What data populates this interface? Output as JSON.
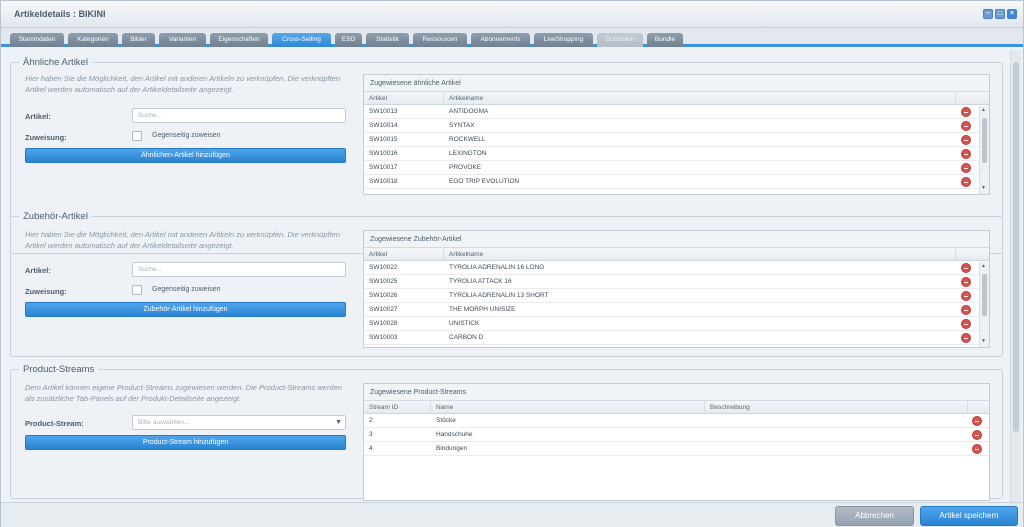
{
  "window": {
    "title": "Artikeldetails : BIKINI",
    "buttons": [
      "min",
      "max",
      "close"
    ]
  },
  "tabs": [
    {
      "label": "Stammdaten",
      "state": "normal"
    },
    {
      "label": "Kategorien",
      "state": "normal"
    },
    {
      "label": "Bilder",
      "state": "normal"
    },
    {
      "label": "Varianten",
      "state": "normal"
    },
    {
      "label": "Eigenschaften",
      "state": "normal"
    },
    {
      "label": "Cross-Selling",
      "state": "active"
    },
    {
      "label": "ESD",
      "state": "normal"
    },
    {
      "label": "Statistik",
      "state": "normal"
    },
    {
      "label": "Ressourcen",
      "state": "normal"
    },
    {
      "label": "Abonnements",
      "state": "normal"
    },
    {
      "label": "LiveShopping",
      "state": "normal"
    },
    {
      "label": "Gutschein",
      "state": "disabled"
    },
    {
      "label": "Bundle",
      "state": "normal"
    }
  ],
  "similar": {
    "legend": "Ähnliche Artikel",
    "description": "Hier haben Sie die Möglichkeit, den Artikel mit anderen Artikeln zu verknüpfen. Die verknüpften Artikel werden automatisch auf der Artikeldetailseite angezeigt.",
    "article_label": "Artikel:",
    "search_placeholder": "Suche...",
    "assignment_label": "Zuweisung:",
    "checkbox_label": "Gegenseitig zuweisen",
    "button": "Ähnlichen-Artikel hinzufügen",
    "grid_title": "Zugewiesene ähnliche Artikel",
    "columns": [
      "Artikel",
      "Artikelname"
    ],
    "rows": [
      [
        "SW10013",
        "ANTIDOGMA"
      ],
      [
        "SW10014",
        "SYNTAX"
      ],
      [
        "SW10015",
        "ROCKWELL"
      ],
      [
        "SW10016",
        "LEXINGTON"
      ],
      [
        "SW10017",
        "PROVOKE"
      ],
      [
        "SW10018",
        "EGO TRIP EVOLUTION"
      ]
    ]
  },
  "accessory": {
    "legend": "Zubehör-Artikel",
    "description": "Hier haben Sie die Möglichkeit, den Artikel mit anderen Artikeln zu verknüpfen. Die verknüpften Artikel werden automatisch auf der Artikeldetailseite angezeigt.",
    "article_label": "Artikel:",
    "search_placeholder": "Suche...",
    "assignment_label": "Zuweisung:",
    "checkbox_label": "Gegenseitig zuweisen",
    "button": "Zubehör-Artikel hinzufügen",
    "grid_title": "Zugewiesene Zubehör-Artikel",
    "columns": [
      "Artikel",
      "Artikelname"
    ],
    "rows": [
      [
        "SW10022",
        "TYROLIA ADRENALIN 16 LONG"
      ],
      [
        "SW10025",
        "TYROLIA ATTACK 16"
      ],
      [
        "SW10026",
        "TYROLIA ADRENALIN 13 SHORT"
      ],
      [
        "SW10027",
        "THE MORPH UNISIZE"
      ],
      [
        "SW10028",
        "UNISTICK"
      ],
      [
        "SW10003",
        "CARBON D"
      ]
    ]
  },
  "streams": {
    "legend": "Product-Streams",
    "description": "Dem Artikel können eigene Product-Streams zugewiesen werden. Die Product-Streams werden als zusätzliche Tab-Panels auf der Produkt-Detailseite angezeigt.",
    "stream_label": "Product-Stream:",
    "select_placeholder": "Bitte auswählen...",
    "button": "Product-Stream hinzufügen",
    "grid_title": "Zugewiesene Product-Streams",
    "columns": [
      "Stream ID",
      "Name",
      "Beschreibung"
    ],
    "rows": [
      [
        "2",
        "Stöcke",
        ""
      ],
      [
        "3",
        "Handschuhe",
        ""
      ],
      [
        "4",
        "Bindungen",
        ""
      ]
    ]
  },
  "footer": {
    "cancel": "Abbrechen",
    "save": "Artikel speichern"
  }
}
